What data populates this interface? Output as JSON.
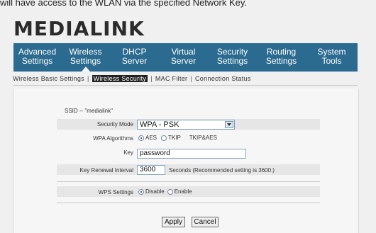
{
  "intro": {
    "text": "will have access to the WLAN via the specified Network Key."
  },
  "logo": {
    "text": "MEDIALINK"
  },
  "nav": {
    "items": [
      {
        "label": "Advanced\nSettings"
      },
      {
        "label": "Wireless\nSettings"
      },
      {
        "label": "DHCP\nServer"
      },
      {
        "label": "Virtual\nServer"
      },
      {
        "label": "Security\nSettings"
      },
      {
        "label": "Routing\nSettings"
      },
      {
        "label": "System\nTools"
      }
    ]
  },
  "subnav": {
    "items": [
      {
        "label": "Wireless Basic Settings"
      },
      {
        "label": "Wireless Security"
      },
      {
        "label": "MAC Filter"
      },
      {
        "label": "Connection Status"
      }
    ]
  },
  "form": {
    "ssid": "SSID -- \"medialink\"",
    "security_mode_label": "Security Mode",
    "security_mode_value": "WPA - PSK",
    "wpa_algorithms_label": "WPA Algorithms",
    "alg_aes": "AES",
    "alg_tkip": "TKIP",
    "alg_tkipaes": "TKIP&AES",
    "key_label": "Key",
    "key_value": "password",
    "renewal_label": "Key Renewal Interval",
    "renewal_value": "3600",
    "renewal_hint": "Seconds (Recommended setting is 3600.)",
    "wps_label": "WPS Settings",
    "wps_disable": "Disable",
    "wps_enable": "Enable",
    "apply_label": "Apply",
    "cancel_label": "Cancel"
  }
}
